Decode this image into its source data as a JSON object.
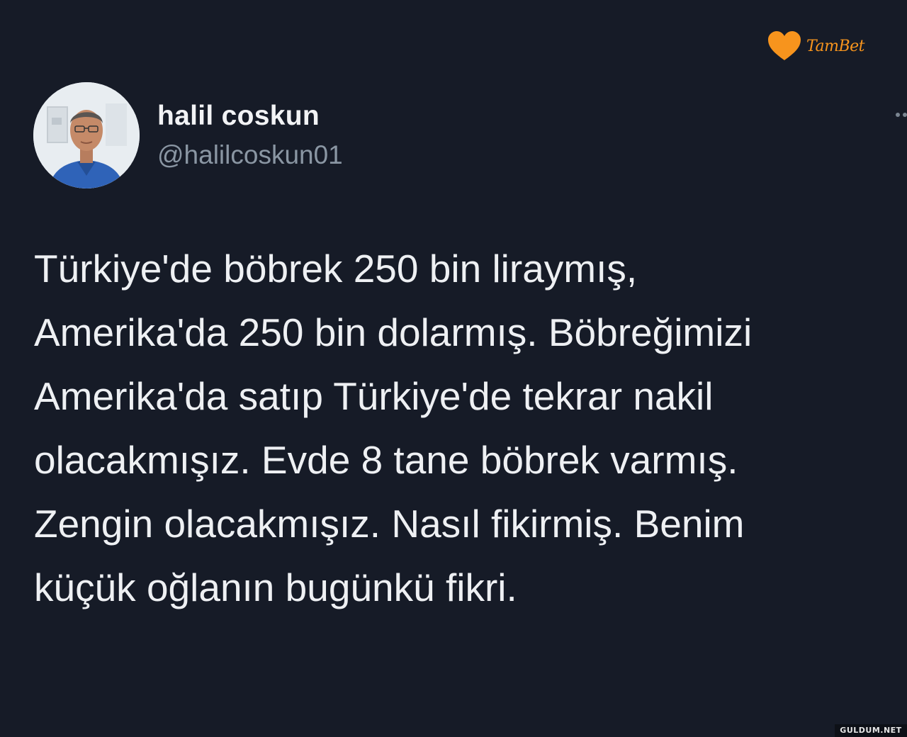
{
  "watermark": {
    "brand_name": "TamBet",
    "brand_icon": "heart-icon",
    "brand_color": "#f7941d",
    "site_name": "GULDUM.NET"
  },
  "tweet": {
    "author": {
      "display_name": "halil coskun",
      "handle": "@halilcoskun01"
    },
    "more_icon": "more-dots-icon",
    "text_lines": [
      "Türkiye'de böbrek 250 bin liraymış,",
      "Amerika'da 250 bin dolarmış. Böbreğimizi",
      "Amerika'da satıp Türkiye'de tekrar nakil",
      "olacakmışız. Evde 8 tane böbrek varmış.",
      "Zengin olacakmışız. Nasıl fikirmiş. Benim",
      "küçük oğlanın bugünkü fikri."
    ]
  },
  "colors": {
    "background": "#161b27",
    "text": "#eef0f3",
    "secondary_text": "#8a96a3"
  }
}
